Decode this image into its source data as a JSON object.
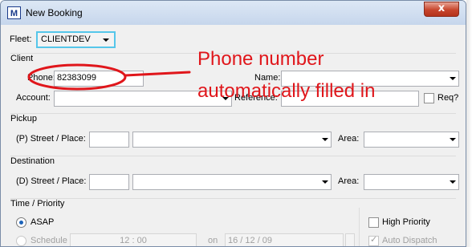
{
  "window": {
    "title": "New Booking",
    "close_label": "x",
    "app_icon_text": "M"
  },
  "fleet": {
    "label": "Fleet:",
    "value": "CLIENTDEV"
  },
  "client": {
    "group_title": "Client",
    "phone_label": "Phone:",
    "phone_value": "82383099",
    "name_label": "Name:",
    "name_value": "",
    "account_label": "Account:",
    "account_value": "",
    "reference_label": "Reference:",
    "reference_value": "",
    "req_label": "Req?"
  },
  "pickup": {
    "group_title": "Pickup",
    "street_label": "(P) Street / Place:",
    "area_label": "Area:"
  },
  "destination": {
    "group_title": "Destination",
    "street_label": "(D) Street / Place:",
    "area_label": "Area:"
  },
  "time": {
    "group_title": "Time / Priority",
    "asap_label": "ASAP",
    "schedule_label": "Schedule",
    "schedule_time": "12 : 00",
    "on_label": "on",
    "schedule_date": "16 / 12 / 09",
    "high_priority_label": "High Priority",
    "auto_dispatch_label": "Auto Dispatch"
  },
  "annotation": {
    "line1": "Phone number",
    "line2": "automatically filled in",
    "color": "#e0161b"
  }
}
